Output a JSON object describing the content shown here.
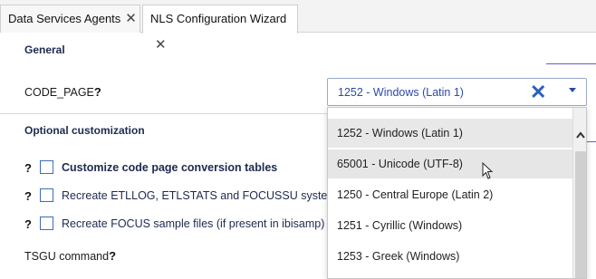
{
  "tabs": [
    {
      "label": "Data Services Agents"
    },
    {
      "label": "NLS Configuration Wizard"
    }
  ],
  "sections": {
    "general": "General",
    "optional": "Optional customization"
  },
  "code_page": {
    "label": "CODE_PAGE",
    "help": "?",
    "value": "1252 - Windows (Latin 1)"
  },
  "options": [
    {
      "label": "Customize code page conversion tables",
      "help": "?"
    },
    {
      "label": "Recreate ETLLOG, ETLSTATS and FOCUSSU system file",
      "help": "?"
    },
    {
      "label": "Recreate FOCUS sample files (if present in ibisamp)",
      "help": "?"
    }
  ],
  "tsgu": {
    "label": "TSGU command",
    "help": "?"
  },
  "dropdown": {
    "items": [
      "1252 - Windows (Latin 1)",
      "65001 - Unicode (UTF-8)",
      "1250 - Central Europe (Latin 2)",
      "1251 - Cyrillic (Windows)",
      "1253 - Greek (Windows)"
    ],
    "selected": "1252 - Windows (Latin 1)",
    "hovered": "65001 - Unicode (UTF-8)"
  },
  "colors": {
    "accent": "#6a5acd",
    "link": "#2b4aa8",
    "heading": "#1d2a50"
  }
}
